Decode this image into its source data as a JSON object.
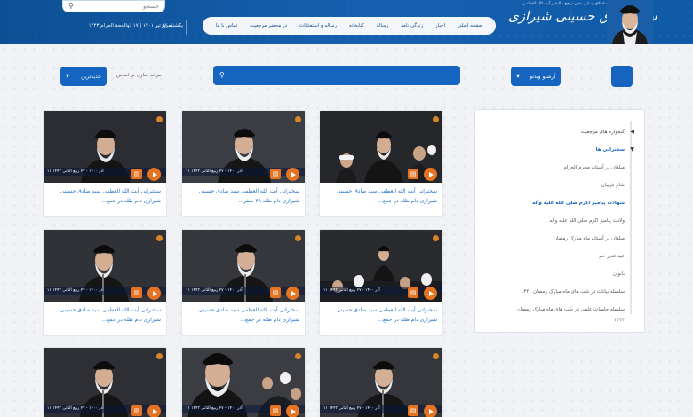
{
  "header": {
    "search_placeholder": "جستجو",
    "today_label": "امروز",
    "date_text": "یکشنبه ۲۶ تیر ۱۴۰۱ | ۱۷ ذوالحجة الحرام ۱۴۴۳",
    "brand_small": "پایگاه اطلاع رسانی دفتر مرجع عالیقدر آیت الله العظمی",
    "brand_name": "سید صادق حسینی شیرازی",
    "nav": [
      "صفحه اصلی",
      "اخبار",
      "زندگی نامه",
      "رساله",
      "کتابخانه",
      "رساله و استفتائات",
      "در محضر مرجعیت",
      "تماس با ما"
    ]
  },
  "filters": {
    "sort_button": "جدیدترین",
    "sort_label": "مرتب سازی بر اساس",
    "archive_button": "آرشیو ویدئو",
    "search_placeholder": ""
  },
  "sidebar": {
    "items": [
      {
        "label": "گنجواره های مرجعیت",
        "level": "root"
      },
      {
        "label": "سخنرانی ها",
        "level": "active"
      },
      {
        "label": "مبلغان در آستانه محرم الحرام",
        "level": "child"
      },
      {
        "label": "شام غریبان",
        "level": "child"
      },
      {
        "label": "شهادت پیامبر اکرم صلی الله علیه وآله",
        "level": "active"
      },
      {
        "label": "ولادت پیامبر اکرم صلی الله علیه وآله",
        "level": "child"
      },
      {
        "label": "مبلغان در آستانه ماه مبارک رمضان",
        "level": "child"
      },
      {
        "label": "عید غدیر خم",
        "level": "child"
      },
      {
        "label": "بانوان",
        "level": "child"
      },
      {
        "label": "سلسله بیانات در شب های ماه مبارک رمضان ۱۴۴۱",
        "level": "child"
      },
      {
        "label": "سلسله جلسات علمی در شب های ماه مبارک رمضان",
        "level": "child"
      },
      {
        "label": "۱۴۴۳",
        "level": "child"
      }
    ]
  },
  "cards": [
    {
      "caption": "۱۱ آذر ۱۴۰۰ - ۲۷ ربیع الثانی ۱۴۴۳",
      "title": "سخنرانی آیت الله العظمی سید صادق حسینی شیرازی دام ظله در جمع..."
    },
    {
      "caption": "۱۱ آذر ۱۴۰۰ - ۲۷ ربیع الثانی ۱۴۴۳",
      "title": "سخنرانی آیت الله العظمی سید صادق حسینی شیرازی دام ظله ۲۸ صفر..."
    },
    {
      "caption": "۱۴۴۳",
      "title": "سخنرانی آیت الله العظمی سید صادق حسینی شیرازی دام ظله در جمع..."
    },
    {
      "caption": "۱۱ آذر ۱۴۰۰ - ۲۷ ربیع الثانی ۱۴۴۳",
      "title": "سخنرانی آیت الله العظمی سید صادق حسینی شیرازی دام ظله در جمع..."
    },
    {
      "caption": "۱۱ آذر ۱۴۰۰ - ۲۷ ربیع الثانی ۱۴۴۳",
      "title": "سخنرانی آیت الله العظمی سید صادق حسینی شیرازی دام ظله در جمع..."
    },
    {
      "caption": "۱۱ آذر ۱۴۰۰ - ۲۷ ربیع الثانی ۱۴۴۳",
      "title": "سخنرانی آیت الله العظمی سید صادق حسینی شیرازی دام ظله در جمع..."
    },
    {
      "caption": "۱۱ آذر ۱۴۰۰ - ۲۷ ربیع الثانی ۱۴۴۳",
      "title": ""
    },
    {
      "caption": "۱۱ آذر ۱۴۰۰ - ۲۷ ربیع الثانی ۱۴۴۳",
      "title": ""
    },
    {
      "caption": "۱۱ آذر ۱۴۰۰ - ۲۷ ربیع الثانی ۱۴۴۳",
      "title": ""
    }
  ],
  "colors": {
    "header_blue": "#1561b0",
    "accent_blue": "#1565c0",
    "link_blue": "#1f6fc6",
    "play_orange": "#e57322"
  }
}
